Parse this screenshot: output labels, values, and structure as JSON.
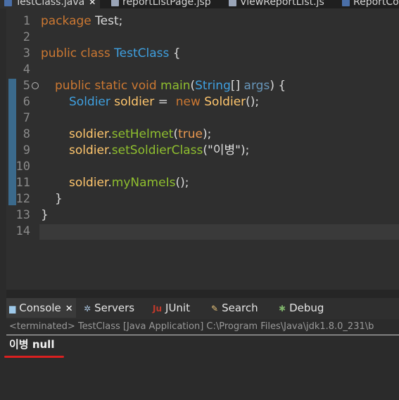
{
  "editor_tabs": [
    {
      "label": "TestClass.java",
      "icon": "java-file-icon",
      "active": true
    },
    {
      "label": "reportListPage.jsp",
      "icon": "jsp-file-icon"
    },
    {
      "label": "ViewReportList.js",
      "icon": "js-file-icon"
    },
    {
      "label": "ReportCo",
      "icon": "java-file-icon"
    }
  ],
  "line_numbers": [
    "1",
    "2",
    "3",
    "4",
    "5",
    "6",
    "7",
    "8",
    "9",
    "10",
    "11",
    "12",
    "13",
    "14"
  ],
  "code": {
    "l1": {
      "kw": "package",
      "name": " Test;"
    },
    "l3": {
      "kw": "public class",
      "name": "TestClass",
      "brace": " {"
    },
    "l5": {
      "kw": "public static void",
      "fn": "main",
      "open": "(",
      "type": "String",
      "brk": "[] ",
      "arg": "args",
      "rest": ") {"
    },
    "l6": {
      "type": "Soldier",
      "var": "soldier",
      "eq": " =  ",
      "kw": "new",
      "ctor": "Soldier",
      "end": "();"
    },
    "l8": {
      "var": "soldier",
      "dot": ".",
      "fn": "setHelmet",
      "open": "(",
      "lit": "true",
      "end": ");"
    },
    "l9": {
      "var": "soldier",
      "dot": ".",
      "fn": "setSoldierClass",
      "open": "(",
      "str": "\"이병\"",
      "end": ");"
    },
    "l11": {
      "var": "soldier",
      "dot": ".",
      "fn": "myNameIs",
      "end": "();"
    },
    "l12": {
      "brace": "}"
    },
    "l13": {
      "brace": "}"
    }
  },
  "console_tabs": [
    {
      "label": "Console",
      "icon": "console-icon",
      "active": true
    },
    {
      "label": "Servers",
      "icon": "servers-icon"
    },
    {
      "label": "JUnit",
      "icon": "junit-icon",
      "icon_text": "Ju"
    },
    {
      "label": "Search",
      "icon": "search-icon"
    },
    {
      "label": "Debug",
      "icon": "debug-icon"
    }
  ],
  "console": {
    "status": "<terminated> TestClass [Java Application] C:\\Program Files\\Java\\jdk1.8.0_231\\b",
    "output": "이병 null"
  },
  "colors": {
    "keyword": "#cc7832",
    "type": "#3fa0e0",
    "method": "#8fbf2f",
    "variable": "#ffc66d",
    "annotation_underline": "#d92020"
  }
}
